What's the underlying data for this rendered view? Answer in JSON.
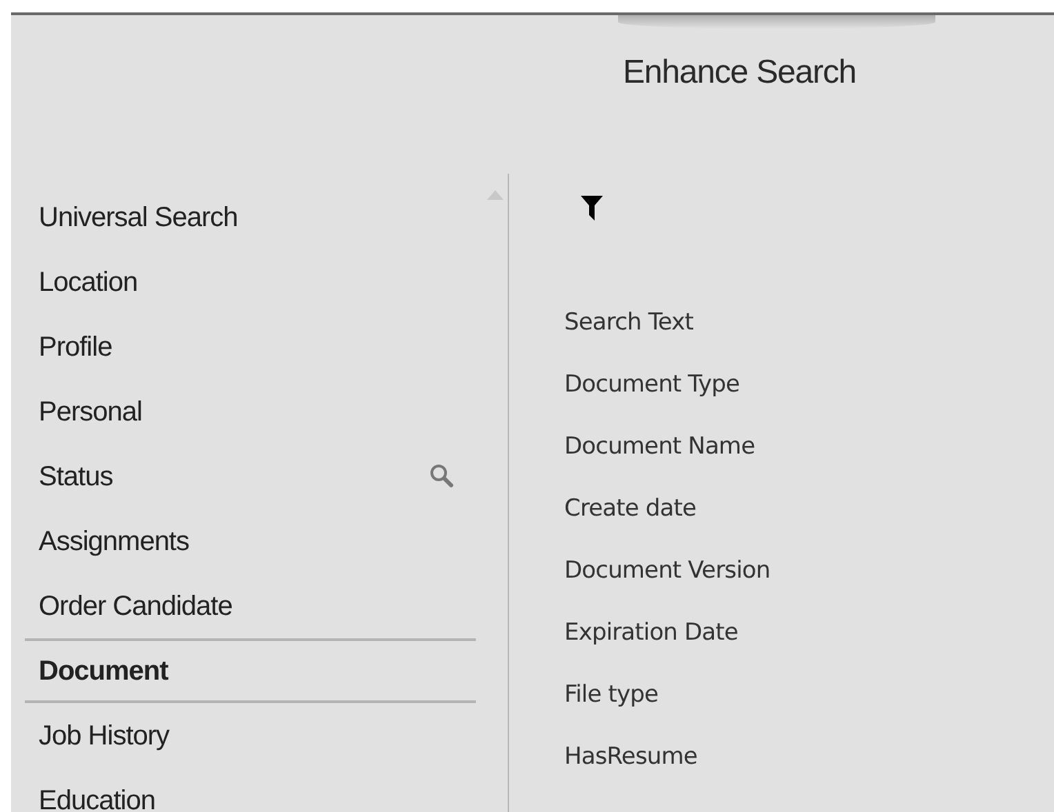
{
  "title": "Enhance Search",
  "categories": [
    {
      "label": "Universal Search",
      "selected": false
    },
    {
      "label": "Location",
      "selected": false
    },
    {
      "label": "Profile",
      "selected": false
    },
    {
      "label": "Personal",
      "selected": false
    },
    {
      "label": "Status",
      "selected": false
    },
    {
      "label": "Assignments",
      "selected": false
    },
    {
      "label": "Order Candidate",
      "selected": false
    },
    {
      "label": "Document",
      "selected": true
    },
    {
      "label": "Job History",
      "selected": false
    },
    {
      "label": "Education",
      "selected": false
    }
  ],
  "fields": [
    "Search Text",
    "Document Type",
    "Document Name",
    "Create date",
    "Document Version",
    "Expiration Date",
    "File type",
    "HasResume"
  ]
}
